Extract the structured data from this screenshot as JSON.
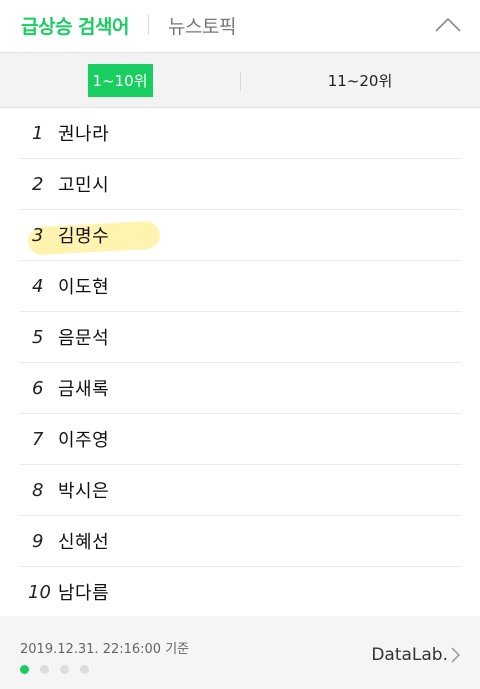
{
  "header": {
    "main_tab": "급상승 검색어",
    "sub_tab": "뉴스토픽",
    "collapse_icon": "chevron-up-icon"
  },
  "range_tabs": [
    {
      "label": "1~10위",
      "selected": true
    },
    {
      "label": "11~20위",
      "selected": false
    }
  ],
  "ranking": [
    {
      "rank": "1",
      "keyword": "권나라"
    },
    {
      "rank": "2",
      "keyword": "고민시"
    },
    {
      "rank": "3",
      "keyword": "김명수",
      "highlighted": true
    },
    {
      "rank": "4",
      "keyword": "이도현"
    },
    {
      "rank": "5",
      "keyword": "음문석"
    },
    {
      "rank": "6",
      "keyword": "금새록"
    },
    {
      "rank": "7",
      "keyword": "이주영"
    },
    {
      "rank": "8",
      "keyword": "박시은"
    },
    {
      "rank": "9",
      "keyword": "신혜선"
    },
    {
      "rank": "10",
      "keyword": "남다름"
    }
  ],
  "footer": {
    "timestamp": "2019.12.31. 22:16:00 기준",
    "brand": "DataLab.",
    "page_dots": 4,
    "active_dot": 1
  },
  "colors": {
    "accent": "#19ce60",
    "highlight": "#ffeb6e"
  }
}
